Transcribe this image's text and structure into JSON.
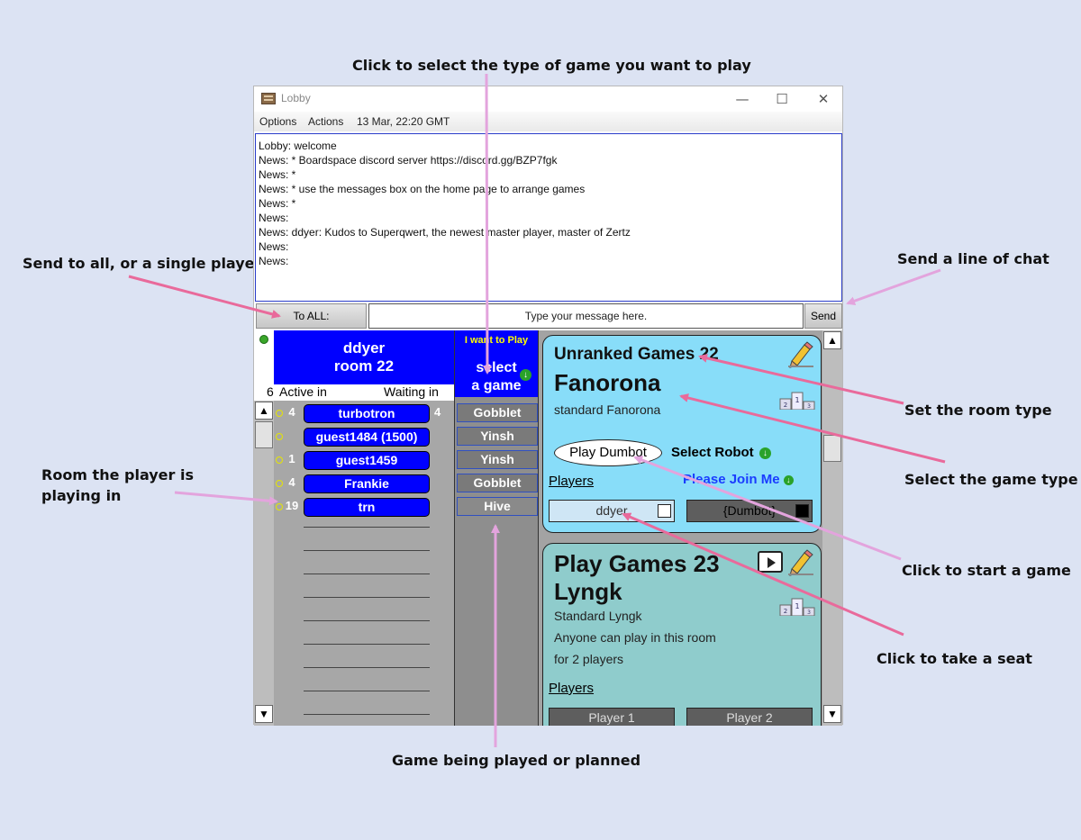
{
  "callouts": {
    "select_game_type": "Click to select the type of game you want to play",
    "send_to": "Send to all, or a single player",
    "send_line": "Send a line of chat",
    "room_type": "Set the room type",
    "game_type": "Select the game type",
    "room_playing_1": "Room the player is",
    "room_playing_2": "playing in",
    "start_game": "Click to start a game",
    "take_seat": "Click to take a seat",
    "game_played": "Game being played or planned"
  },
  "window": {
    "title": "Lobby",
    "menu": [
      "Options",
      "Actions",
      "13 Mar, 22:20 GMT"
    ],
    "controls": [
      "—",
      "☐",
      "✕"
    ]
  },
  "chat": {
    "lines": [
      "Lobby: welcome",
      "News: * Boardspace discord server https://discord.gg/BZP7fgk",
      "News: *",
      "News: * use the messages box on the home page to arrange games",
      "News: *",
      "News:",
      "News: ddyer: Kudos to Superqwert, the newest master player, master of Zertz",
      "News:",
      "News:"
    ]
  },
  "input_row": {
    "to_label": "To ALL:",
    "message_placeholder": "Type your message here.",
    "send_label": "Send"
  },
  "header": {
    "name": "ddyer",
    "room": "room 22",
    "count": "6",
    "active_label": "Active in",
    "waiting_label": "Waiting in"
  },
  "players": [
    {
      "active": "4",
      "name": "turbotron",
      "waiting": "4",
      "game": "Gobblet"
    },
    {
      "active": "",
      "name": "guest1484 (1500)",
      "waiting": "",
      "game": "Yinsh"
    },
    {
      "active": "1",
      "name": "guest1459",
      "waiting": "",
      "game": "Yinsh"
    },
    {
      "active": "4",
      "name": "Frankie",
      "waiting": "",
      "game": "Gobblet"
    },
    {
      "active": "19",
      "name": "trn",
      "waiting": "",
      "game": "Hive"
    }
  ],
  "want": {
    "line1": "I want to Play",
    "line2": "select",
    "line3": "a game"
  },
  "room1": {
    "title": "Unranked Games 22",
    "game": "Fanorona",
    "variant": "standard Fanorona",
    "play_button": "Play Dumbot",
    "select_robot": "Select Robot",
    "players_label": "Players",
    "please_join": "Please Join Me",
    "seat1": "ddyer",
    "seat2": "{Dumbot}"
  },
  "room2": {
    "title": "Play Games 23",
    "game": "Lyngk",
    "variant": "Standard Lyngk",
    "desc1": "Anyone can play in this room",
    "desc2": "for 2 players",
    "players_label": "Players",
    "seat1": "Player 1",
    "seat2": "Player 2"
  },
  "icons": {
    "app": "lobby-app-icon",
    "pencil": "pencil-icon",
    "trophy": "podium-icon",
    "video": "video-icon",
    "green_arrow": "green-down-arrow-icon"
  },
  "colors": {
    "accent_blue": "#0000ff",
    "card1_bg": "#88ddf9",
    "card2_bg": "#8fcccc",
    "arrow_pink": "#e96a9b",
    "arrow_violet": "#e3a4dd"
  }
}
